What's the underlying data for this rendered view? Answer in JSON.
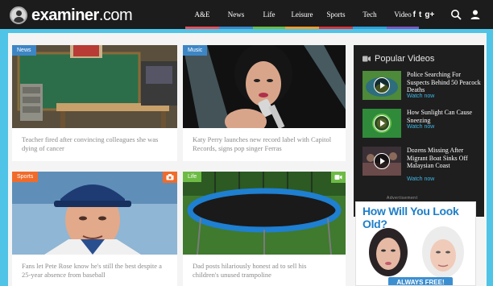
{
  "header": {
    "logo": "examiner",
    "logo_suffix": ".com",
    "nav": [
      {
        "label": "A&E",
        "color": "#e94f5b",
        "width": 42
      },
      {
        "label": "News",
        "color": "#3d86c6",
        "width": 42
      },
      {
        "label": "Life",
        "color": "#6dbb45",
        "width": 40
      },
      {
        "label": "Leisure",
        "color": "#f39c2b",
        "width": 42
      },
      {
        "label": "Sports",
        "color": "#d9363e",
        "width": 42
      },
      {
        "label": "Tech",
        "color": "#2f9fd8",
        "width": 42
      },
      {
        "label": "Video",
        "color": "#7e57c2",
        "width": 40
      }
    ],
    "social": {
      "facebook": "f",
      "twitter": "t",
      "googleplus": "g+"
    }
  },
  "cards": [
    {
      "tag": "News",
      "tag_color": "#3d86c6",
      "caption": "Teacher fired after convincing colleagues she was dying of cancer"
    },
    {
      "tag": "Music",
      "tag_color": "#3d86c6",
      "caption": "Katy Perry launches new record label with Capitol Records, signs pop singer Ferras"
    },
    {
      "tag": "Sports",
      "tag_color": "#f06b2b",
      "caption": "Fans let Pete Rose know he's still the best despite a 25-year absence from baseball"
    },
    {
      "tag": "Life",
      "tag_color": "#6dbb45",
      "caption": "Dad posts hilariously honest ad to sell his children's unused trampoline"
    }
  ],
  "popular": {
    "title": "Popular Videos",
    "watch_label": "Watch now",
    "items": [
      {
        "title": "Police Searching For Suspects Behind 50 Peacock Deaths"
      },
      {
        "title": "How Sunlight Can Cause Sneezing"
      },
      {
        "title": "Dozens Missing After Migrant Boat Sinks Off Malaysian Coast"
      }
    ]
  },
  "ad": {
    "label": "Advertisement",
    "headline": "How Will You Look Old?",
    "button": "ALWAYS FREE!"
  },
  "colors": {
    "header_bg": "#1c1c1c",
    "page_bg": "#4fc4e6",
    "accent": "#3fb7e6"
  }
}
